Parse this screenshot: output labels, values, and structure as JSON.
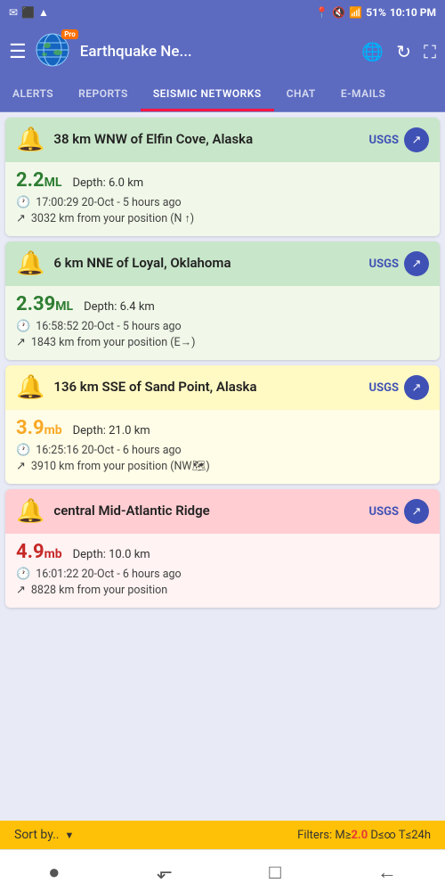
{
  "statusBar": {
    "leftIcons": [
      "✉",
      "⬛",
      "▲"
    ],
    "centerIcon": "📍",
    "rightItems": [
      "🔇",
      "📶",
      "51%",
      "10:10 PM"
    ]
  },
  "header": {
    "menuIcon": "☰",
    "title": "Earthquake Ne...",
    "proBadge": "Pro",
    "globeIcon": "🌐",
    "refreshIcon": "↻",
    "expandIcon": "⛶"
  },
  "tabs": [
    {
      "id": "alerts",
      "label": "ALERTS",
      "active": false
    },
    {
      "id": "reports",
      "label": "REPORTS",
      "active": false
    },
    {
      "id": "seismic",
      "label": "SEISMIC NETWORKS",
      "active": true
    },
    {
      "id": "chat",
      "label": "CHAT",
      "active": false
    },
    {
      "id": "emails",
      "label": "E-MAILS",
      "active": false
    }
  ],
  "earthquakes": [
    {
      "id": "eq1",
      "location": "38 km WNW of Elfin Cove, Alaska",
      "magnitude": "2.2",
      "magnitudeType": "ML",
      "depth": "Depth: 6.0 km",
      "time": "17:00:29 20-Oct - 5 hours ago",
      "distance": "3032 km from your position (N ↑)",
      "source": "USGS",
      "colorScheme": "green"
    },
    {
      "id": "eq2",
      "location": "6 km NNE of Loyal, Oklahoma",
      "magnitude": "2.39",
      "magnitudeType": "ML",
      "depth": "Depth: 6.4 km",
      "time": "16:58:52 20-Oct - 5 hours ago",
      "distance": "1843 km from your position (E→)",
      "source": "USGS",
      "colorScheme": "green"
    },
    {
      "id": "eq3",
      "location": "136 km SSE of Sand Point, Alaska",
      "magnitude": "3.9",
      "magnitudeType": "mb",
      "depth": "Depth: 21.0 km",
      "time": "16:25:16 20-Oct - 6 hours ago",
      "distance": "3910 km from your position (NW🗺)",
      "source": "USGS",
      "colorScheme": "yellow"
    },
    {
      "id": "eq4",
      "location": "central Mid-Atlantic Ridge",
      "magnitude": "4.9",
      "magnitudeType": "mb",
      "depth": "Depth: 10.0 km",
      "time": "16:01:22 20-Oct - 6 hours ago",
      "distance": "8828 km from your position",
      "source": "USGS",
      "colorScheme": "red"
    }
  ],
  "bottomBar": {
    "sortLabel": "Sort by..",
    "dropdownIcon": "▼",
    "filterText": "Filters: M≥",
    "filterMag": "2.0",
    "filterRest": " D≤∞ T≤24h"
  },
  "navBar": {
    "items": [
      "●",
      "⬐",
      "□",
      "←"
    ]
  }
}
